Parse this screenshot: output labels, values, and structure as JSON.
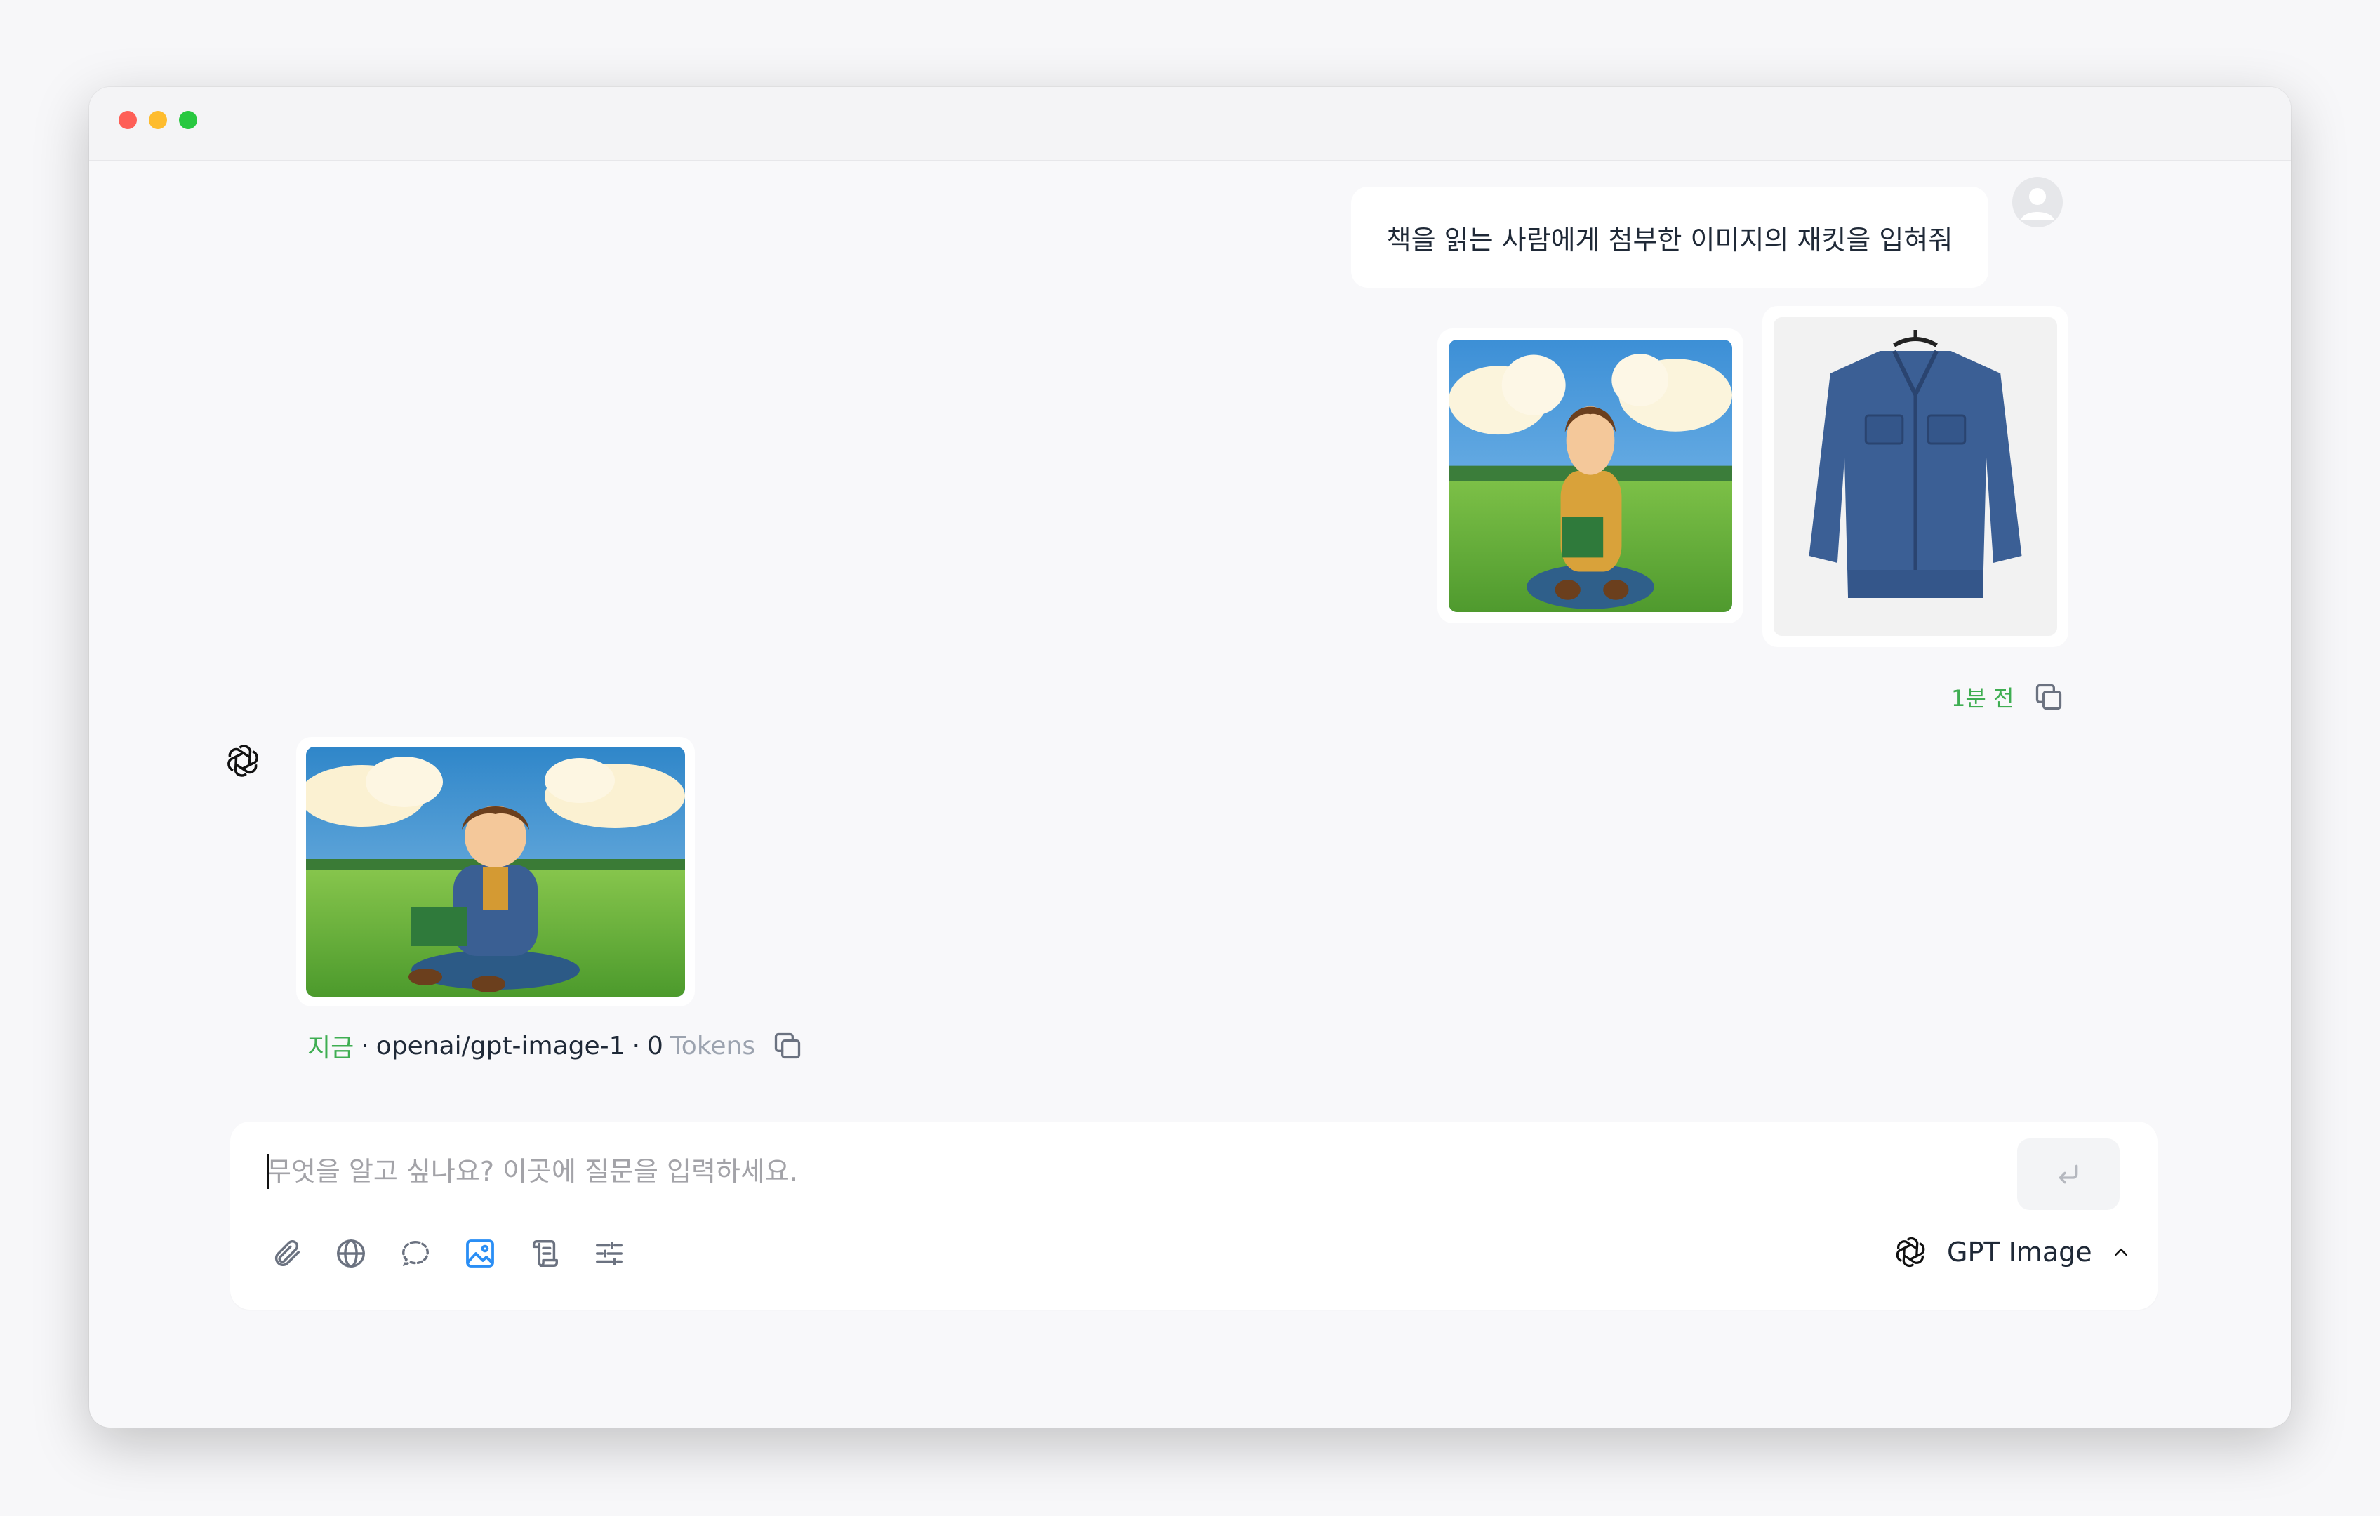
{
  "user_message": {
    "text": "책을 읽는 사람에게 첨부한 이미지의 재킷을 입혀줘",
    "time": "1분 전"
  },
  "assistant_message": {
    "time": "지금",
    "model": "openai/gpt-image-1",
    "token_count": "0",
    "token_label": "Tokens"
  },
  "composer": {
    "placeholder": "무엇을 알고 싶나요? 이곳에 질문을 입력하세요.",
    "model_label": "GPT Image"
  },
  "colors": {
    "accent_green": "#3fae52",
    "accent_blue": "#2a8ef5",
    "icon_gray": "#6b7280"
  }
}
